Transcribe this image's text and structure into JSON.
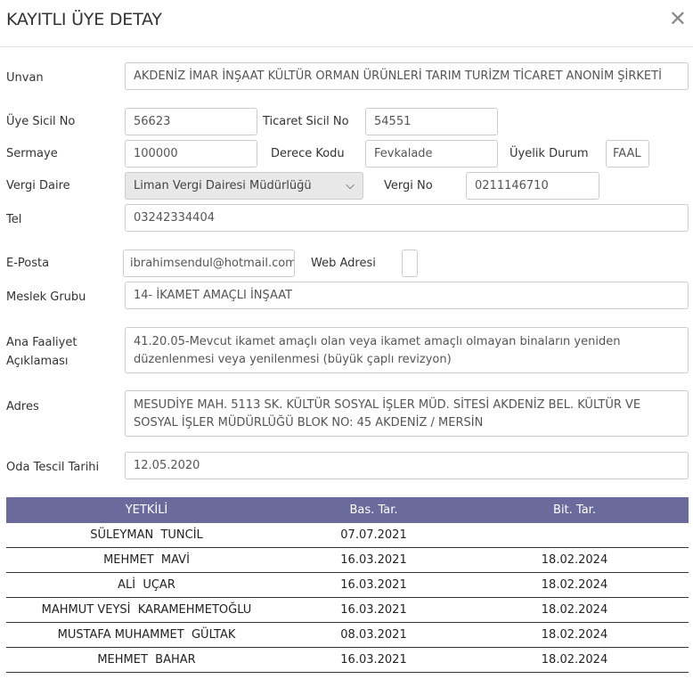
{
  "dialog": {
    "title": "KAYITLI ÜYE DETAY",
    "close_glyph": "✕"
  },
  "labels": {
    "unvan": "Unvan",
    "uye_sicil_no": "Üye Sicil No",
    "ticaret_sicil_no": "Ticaret Sicil No",
    "sermaye": "Sermaye",
    "derece_kodu": "Derece Kodu",
    "uyelik_durum": "Üyelik Durum",
    "vergi_daire": "Vergi Daire",
    "vergi_no": "Vergi No",
    "tel": "Tel",
    "e_posta": "E-Posta",
    "web_adresi": "Web Adresi",
    "meslek_grubu": "Meslek Grubu",
    "ana_faaliyet_1": "Ana Faaliyet",
    "ana_faaliyet_2": "Açıklaması",
    "adres": "Adres",
    "oda_tescil_tarihi": "Oda Tescil Tarihi"
  },
  "values": {
    "unvan": "AKDENİZ İMAR İNŞAAT KÜLTÜR ORMAN ÜRÜNLERİ TARIM TURİZM TİCARET ANONİM ŞİRKETİ",
    "uye_sicil_no": "56623",
    "ticaret_sicil_no": "54551",
    "sermaye": "100000",
    "derece_kodu": "Fevkalade",
    "uyelik_durum": "FAAL",
    "vergi_daire": "Liman Vergi Dairesi Müdürlüğü",
    "vergi_no": "0211146710",
    "tel": "03242334404",
    "e_posta": "ibrahimsendul@hotmail.com",
    "web_adresi": "",
    "meslek_grubu": "14- İKAMET AMAÇLI İNŞAAT",
    "ana_faaliyet": "41.20.05-Mevcut ikamet amaçlı olan veya ikamet amaçlı olmayan binaların yeniden düzenlenmesi veya yenilenmesi (büyük çaplı revizyon)",
    "adres": "MESUDİYE MAH. 5113 SK. KÜLTÜR SOSYAL İŞLER MÜD. SİTESİ AKDENİZ BEL. KÜLTÜR VE SOSYAL İŞLER MÜDÜRLÜĞÜ BLOK NO: 45 AKDENİZ / MERSİN",
    "oda_tescil_tarihi": "12.05.2020"
  },
  "icons": {
    "close": "close-icon",
    "dropdown": "chevron-down-icon"
  },
  "colors": {
    "table_header_bg": "#6a6a9c",
    "table_header_text": "#ffffff",
    "select_bg": "#e8e8e8",
    "border": "#cccccc"
  },
  "table": {
    "headers": [
      "YETKİLİ",
      "Bas. Tar.",
      "Bit. Tar."
    ],
    "rows": [
      [
        "SÜLEYMAN  TUNCİL",
        "07.07.2021",
        ""
      ],
      [
        "MEHMET  MAVİ",
        "16.03.2021",
        "18.02.2024"
      ],
      [
        "ALİ  UÇAR",
        "16.03.2021",
        "18.02.2024"
      ],
      [
        "MAHMUT VEYSİ  KARAMEHMETOĞLU",
        "16.03.2021",
        "18.02.2024"
      ],
      [
        "MUSTAFA MUHAMMET  GÜLTAK",
        "08.03.2021",
        "18.02.2024"
      ],
      [
        "MEHMET  BAHAR",
        "16.03.2021",
        "18.02.2024"
      ]
    ]
  }
}
